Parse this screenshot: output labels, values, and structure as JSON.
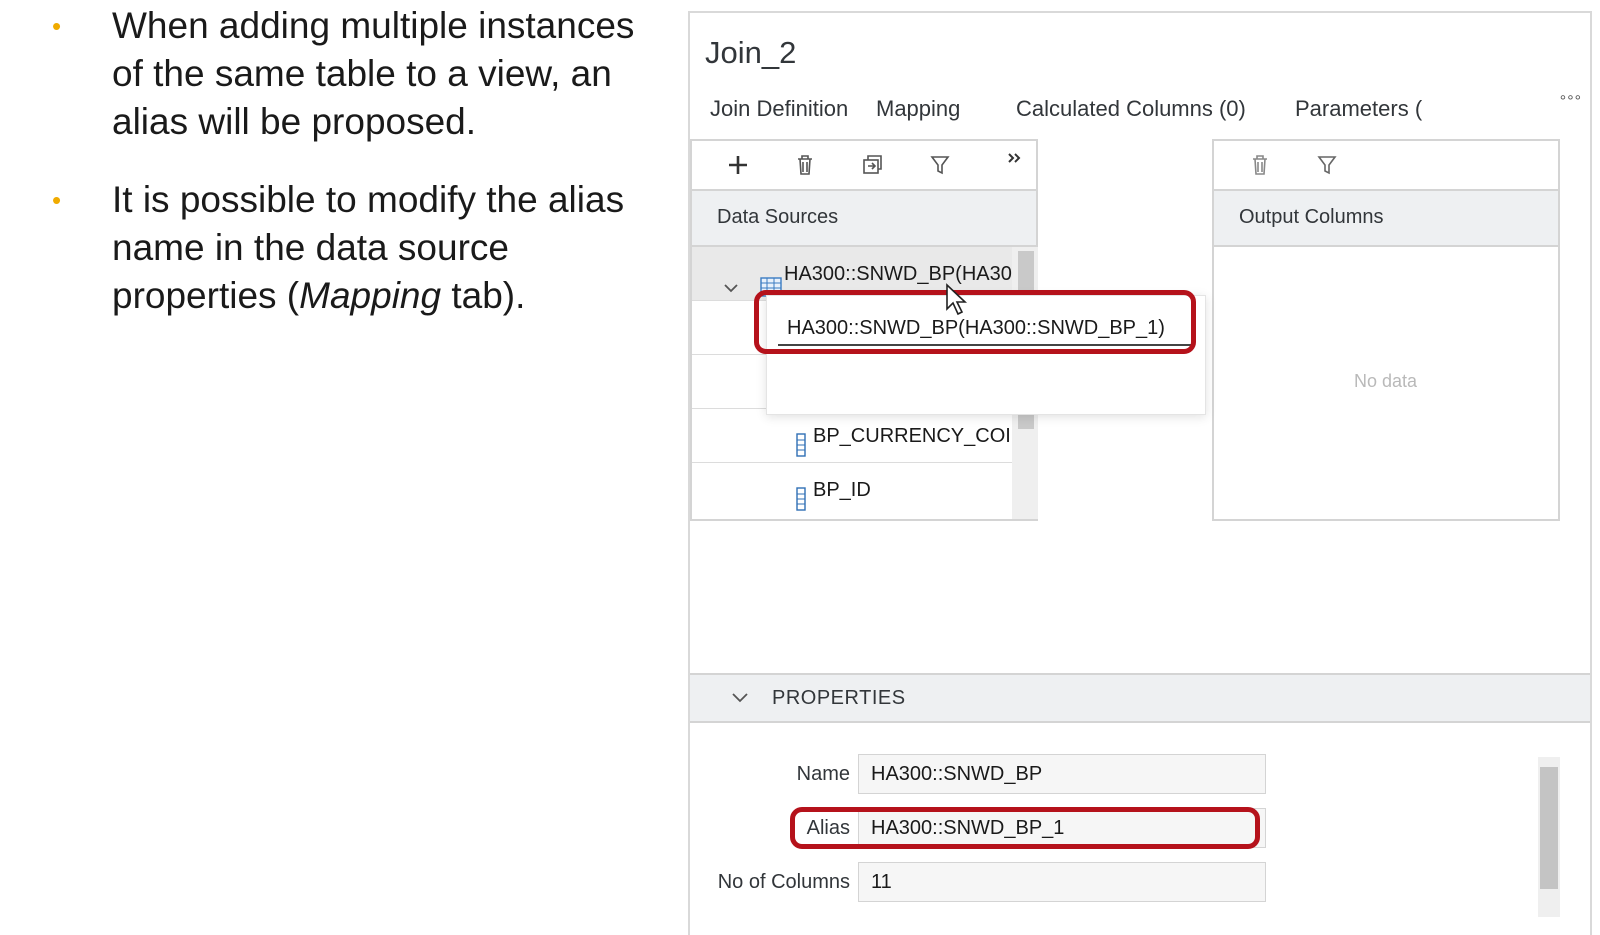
{
  "slide": {
    "bullets": [
      {
        "text": "When adding multiple instances of the same table to a view, an alias will be proposed."
      },
      {
        "text_before": "It is possible to modify the alias name in the data source properties (",
        "text_italic": "Mapping",
        "text_after": " tab)."
      }
    ]
  },
  "editor": {
    "view_title": "Join_2",
    "tabs": [
      "Join Definition",
      "Mapping",
      "Calculated Columns (0)",
      "Parameters ("
    ],
    "active_tab": "Mapping",
    "more_icon": "more-icon",
    "data_sources": {
      "header": "Data Sources",
      "toolbar_icons": [
        "add-icon",
        "delete-icon",
        "copy-icon",
        "filter-icon",
        "expand-icon"
      ],
      "table_node": "HA300::SNWD_BP(HA30",
      "columns": [
        "BP_CURRENCY_COI",
        "BP_ID"
      ]
    },
    "alias_popup": {
      "value": "HA300::SNWD_BP(HA300::SNWD_BP_1)"
    },
    "output_columns": {
      "header": "Output Columns",
      "toolbar_icons": [
        "delete-icon",
        "filter-icon"
      ],
      "empty_text": "No data"
    },
    "properties": {
      "title": "PROPERTIES",
      "fields": [
        {
          "label": "Name",
          "value": "HA300::SNWD_BP"
        },
        {
          "label": "Alias",
          "value": "HA300::SNWD_BP_1"
        },
        {
          "label": "No of Columns",
          "value": "11"
        }
      ]
    },
    "colors": {
      "accent": "#0a6ed1",
      "highlight": "#b5121b",
      "bullet": "#f0ab00"
    }
  }
}
